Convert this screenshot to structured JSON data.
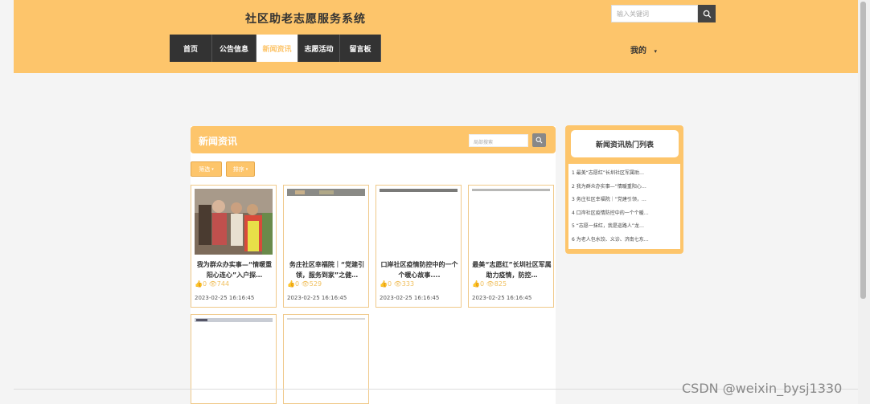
{
  "header": {
    "site_title": "社区助老志愿服务系统",
    "search_placeholder": "输入关键词",
    "my_label": "我的"
  },
  "nav": [
    {
      "label": "首页",
      "active": false
    },
    {
      "label": "公告信息",
      "active": false
    },
    {
      "label": "新闻资讯",
      "active": true
    },
    {
      "label": "志愿活动",
      "active": false
    },
    {
      "label": "留言板",
      "active": false
    }
  ],
  "main": {
    "title": "新闻资讯",
    "local_search_placeholder": "局部搜索",
    "filter_label": "筛选",
    "sort_label": "排序"
  },
  "cards": [
    {
      "title": "我为群众办实事—“情暖重阳心连心”入户探…",
      "likes": "0",
      "views": "744",
      "date": "2023-02-25 16:16:45"
    },
    {
      "title": "务庄社区幸福院｜“党建引领，服务到家”之健…",
      "likes": "0",
      "views": "529",
      "date": "2023-02-25 16:16:45"
    },
    {
      "title": "口岸社区疫情防控中的一个个暖心故事....",
      "likes": "0",
      "views": "333",
      "date": "2023-02-25 16:16:45"
    },
    {
      "title": "最美“志愿红”长圳社区军属助力疫情，防控…",
      "likes": "0",
      "views": "825",
      "date": "2023-02-25 16:16:45"
    }
  ],
  "sidebar": {
    "title": "新闻资讯热门列表",
    "items": [
      "1  最美“志愿红”长圳社区军属助…",
      "2  我为群众办实事—“情暖重阳心…",
      "3  务庄社区幸福院｜“党建引领，…",
      "4  口岸社区疫情防控中的一个个暖…",
      "5  “志愿一抹红，我是巡路人”龙…",
      "6  为老人包水饺、义诊、济南七东…"
    ]
  },
  "watermark": "CSDN @weixin_bysj1330",
  "colors": {
    "accent": "#fdc56b",
    "nav_bg": "#333333"
  }
}
